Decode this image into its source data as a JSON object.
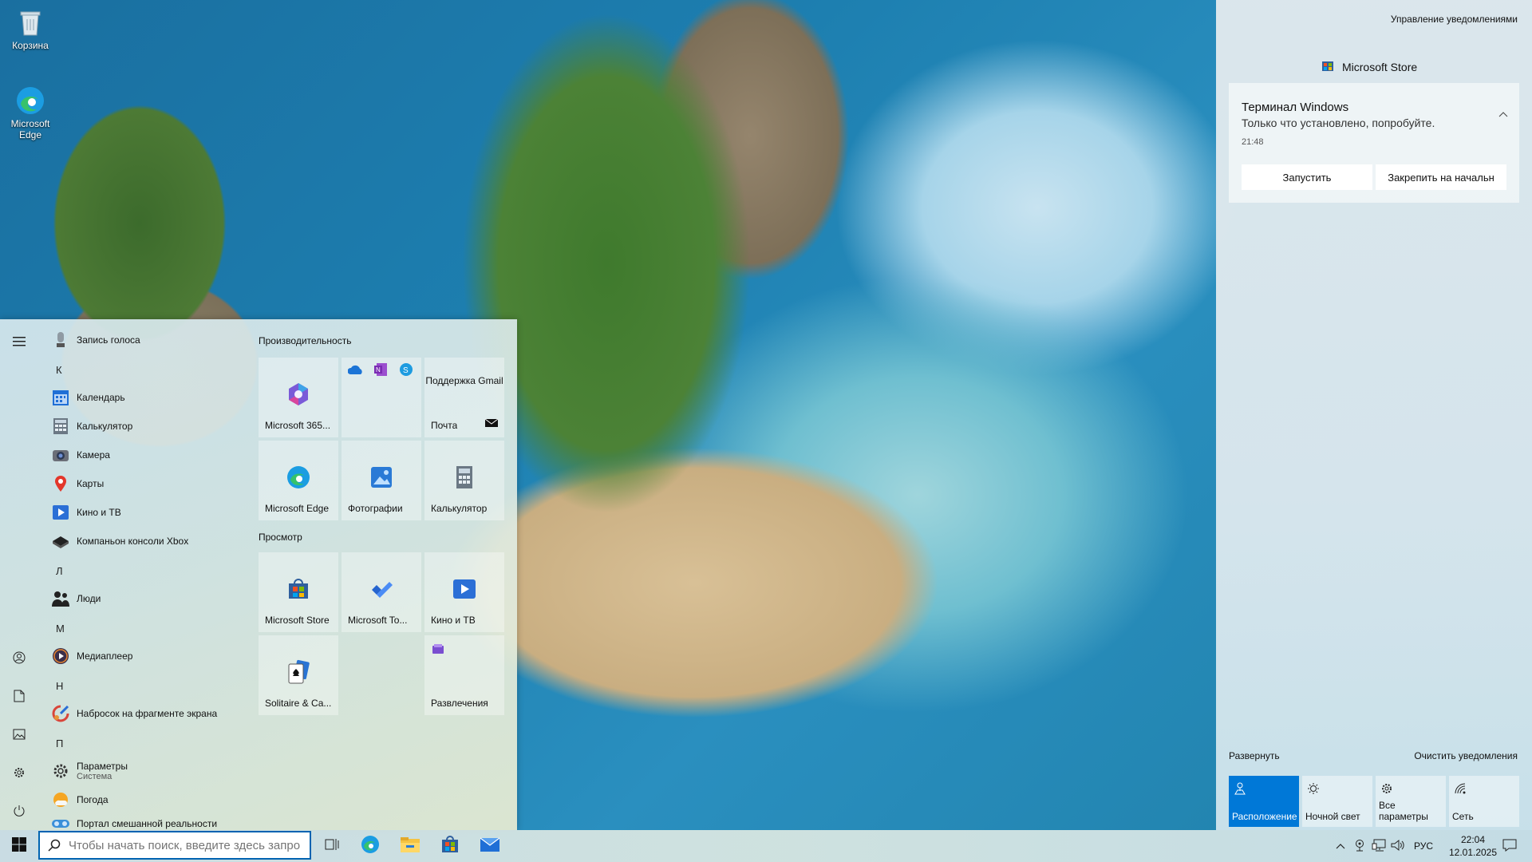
{
  "desktop": {
    "icons": [
      {
        "label": "Корзина",
        "icon": "recycle-bin-icon"
      },
      {
        "label": "Microsoft Edge",
        "icon": "edge-icon"
      }
    ]
  },
  "start_menu": {
    "app_list": {
      "items": [
        {
          "label": "Запись голоса",
          "icon": "voice-recorder-icon"
        },
        {
          "letter": "К"
        },
        {
          "label": "Календарь",
          "icon": "calendar-icon"
        },
        {
          "label": "Калькулятор",
          "icon": "calculator-icon"
        },
        {
          "label": "Камера",
          "icon": "camera-icon"
        },
        {
          "label": "Карты",
          "icon": "maps-icon"
        },
        {
          "label": "Кино и ТВ",
          "icon": "movies-tv-icon"
        },
        {
          "label": "Компаньон консоли Xbox",
          "icon": "xbox-icon"
        },
        {
          "letter": "Л"
        },
        {
          "label": "Люди",
          "icon": "people-icon"
        },
        {
          "letter": "М"
        },
        {
          "label": "Медиаплеер",
          "icon": "media-player-icon"
        },
        {
          "letter": "Н"
        },
        {
          "label": "Набросок на фрагменте экрана",
          "icon": "snip-sketch-icon"
        },
        {
          "letter": "П"
        },
        {
          "label": "Параметры",
          "sublabel": "Система",
          "icon": "settings-icon"
        },
        {
          "label": "Погода",
          "icon": "weather-icon"
        },
        {
          "label": "Портал смешанной реальности",
          "icon": "mixed-reality-icon"
        }
      ]
    },
    "groups": [
      {
        "title": "Производительность"
      },
      {
        "title": "Просмотр"
      }
    ],
    "tiles": {
      "m365": "Microsoft 365...",
      "gmail_support": "Поддержка Gmail",
      "mail": "Почта",
      "edge": "Microsoft Edge",
      "photos": "Фотографии",
      "calculator": "Калькулятор",
      "store": "Microsoft Store",
      "todo": "Microsoft To...",
      "movies": "Кино и ТВ",
      "solitaire": "Solitaire & Ca...",
      "entertainment": "Развлечения"
    }
  },
  "action_center": {
    "manage": "Управление уведомлениями",
    "app_name": "Microsoft Store",
    "notification": {
      "title": "Терминал Windows",
      "body": "Только что установлено, попробуйте.",
      "time": "21:48",
      "btn_launch": "Запустить",
      "btn_pin": "Закрепить на начальн"
    },
    "expand": "Развернуть",
    "clear": "Очистить уведомления",
    "quick_actions": [
      {
        "label": "Расположение",
        "icon": "location-icon",
        "active": true
      },
      {
        "label": "Ночной свет",
        "icon": "night-light-icon",
        "active": false
      },
      {
        "label": "Все параметры",
        "icon": "settings-icon",
        "active": false
      },
      {
        "label": "Сеть",
        "icon": "network-icon",
        "active": false
      }
    ]
  },
  "taskbar": {
    "search_placeholder": "Чтобы начать поиск, введите здесь запрос",
    "language": "РУС",
    "time": "22:04",
    "date": "12.01.2025"
  },
  "colors": {
    "accent": "#0078d7",
    "search_border": "#0063b1"
  }
}
